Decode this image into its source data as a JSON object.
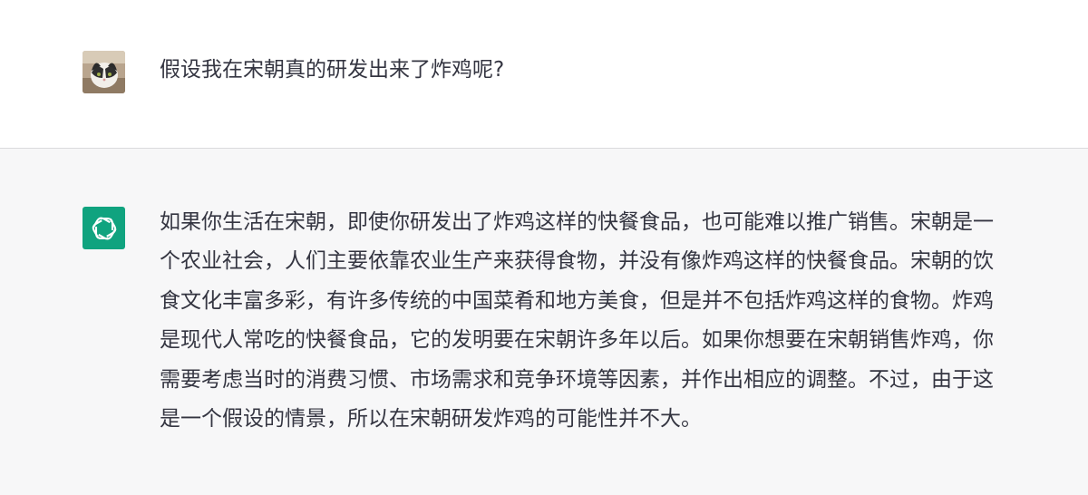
{
  "theme": {
    "user_row_bg": "#ffffff",
    "assistant_row_bg": "#f7f7f8",
    "assistant_avatar_bg": "#10a37f",
    "text_color": "#343541",
    "divider_color": "#dadadd"
  },
  "user_message": {
    "avatar_icon": "cat-photo-avatar",
    "text": "假设我在宋朝真的研发出来了炸鸡呢?"
  },
  "assistant_message": {
    "avatar_icon": "openai-logo-icon",
    "lines": [
      "如果你生活在宋朝，即使你研发出了炸鸡这样的快餐食品，也可能难以推广销售。宋朝是一",
      "个农业社会，人们主要依靠农业生产来获得食物，并没有像炸鸡这样的快餐食品。宋朝的饮",
      "食文化丰富多彩，有许多传统的中国菜肴和地方美食，但是并不包括炸鸡这样的食物。炸鸡",
      "是现代人常吃的快餐食品，它的发明要在宋朝许多年以后。如果你想要在宋朝销售炸鸡，你",
      "需要考虑当时的消费习惯、市场需求和竞争环境等因素，并作出相应的调整。不过，由于这",
      "是一个假设的情景，所以在宋朝研发炸鸡的可能性并不大。"
    ]
  }
}
